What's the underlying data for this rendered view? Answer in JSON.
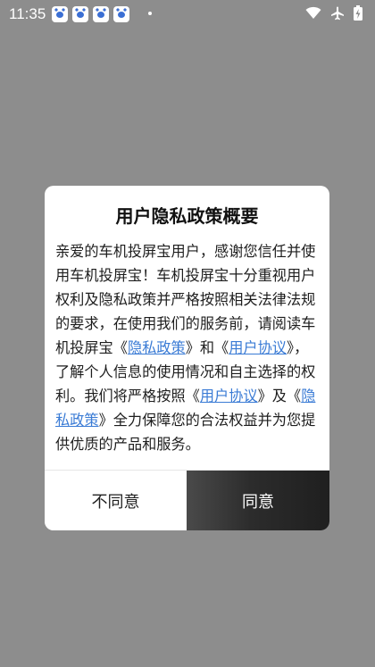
{
  "status_bar": {
    "time": "11:35",
    "app_icons": [
      "baidu-icon",
      "baidu-icon",
      "baidu-icon",
      "baidu-icon"
    ]
  },
  "dialog": {
    "title": "用户隐私政策概要",
    "body": {
      "part1": "亲爱的车机投屏宝用户，感谢您信任并使用车机投屏宝！车机投屏宝十分重视用户权利及隐私政策并严格按照相关法律法规的要求，在使用我们的服务前，请阅读车机投屏宝《",
      "link_privacy_1": "隐私政策",
      "part2": "》和《",
      "link_agreement_1": "用户协议",
      "part3": "》，了解个人信息的使用情况和自主选择的权利。我们将严格按照《",
      "link_agreement_2": "用户协议",
      "part4": "》及《",
      "link_privacy_2": "隐私政策",
      "part5": "》全力保障您的合法权益并为您提供优质的产品和服务。"
    },
    "disagree_label": "不同意",
    "agree_label": "同意"
  },
  "colors": {
    "overlay": "#8d8d8d",
    "link": "#3a7bd5",
    "agree_button": "#2c2c2c"
  }
}
